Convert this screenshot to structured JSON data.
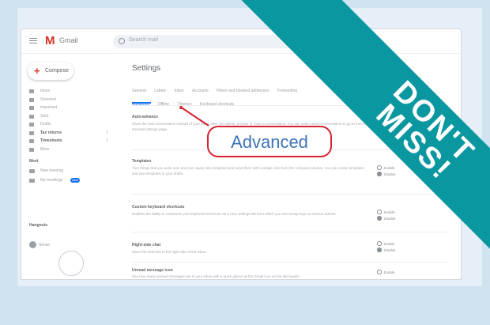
{
  "app": {
    "logo_mark": "M",
    "logo_word": "Gmail",
    "search_placeholder": "Search mail"
  },
  "sidebar": {
    "compose_label": "Compose",
    "items": [
      {
        "label": "Inbox",
        "count": ""
      },
      {
        "label": "Snoozed",
        "count": ""
      },
      {
        "label": "Important",
        "count": ""
      },
      {
        "label": "Sent",
        "count": ""
      },
      {
        "label": "Drafts",
        "count": ""
      },
      {
        "label": "Tax returns",
        "count": "1",
        "bold": true
      },
      {
        "label": "Timesheets",
        "count": "1",
        "bold": true
      },
      {
        "label": "More",
        "count": ""
      }
    ],
    "meet_label": "Meet",
    "meet_items": [
      {
        "label": "New meeting"
      },
      {
        "label": "My meetings",
        "badge": "New"
      }
    ],
    "hangouts_label": "Hangouts",
    "hangouts_user": "Simon"
  },
  "main": {
    "page_title": "Settings",
    "tabs": [
      "General",
      "Labels",
      "Inbox",
      "Accounts",
      "Filters and blocked addresses",
      "Forwarding"
    ],
    "subtabs": [
      "Advanced",
      "Offline",
      "Themes",
      "Keyboard shortcuts"
    ],
    "settings": [
      {
        "title": "Auto-advance",
        "desc": "Show the next conversation instead of your inbox after you delete, archive or mute a conversation. You can select which conversation to go to from the General settings page."
      },
      {
        "title": "Templates",
        "desc": "Turn things that you write over and over again into templates and send them with a single click from the compose window. You can create templates and use templates in your drafts.",
        "opt1": "Enable",
        "opt2": "Disable"
      },
      {
        "title": "Custom keyboard shortcuts",
        "desc": "Enables the ability to customise your keyboard shortcuts via a new settings tab from which you can remap keys to various actions.",
        "opt1": "Enable",
        "opt2": "Disable"
      },
      {
        "title": "Right-side chat",
        "desc": "Move the chat box to the right side of the inbox.",
        "opt1": "Enable",
        "opt2": "Disable"
      },
      {
        "title": "Unread message icon",
        "desc": "See how many unread messages are in your inbox with a quick glance at the Gmail icon on the tab header.",
        "opt1": "Enable",
        "opt2": "Disable"
      }
    ]
  },
  "callout": {
    "label": "Advanced"
  },
  "banner": {
    "line1": "DON'T",
    "line2": "MISS!"
  },
  "colors": {
    "banner": "#0b97a0",
    "callout_border": "#d5232f",
    "callout_text": "#3d74b6",
    "background": "#cfe3f1"
  }
}
